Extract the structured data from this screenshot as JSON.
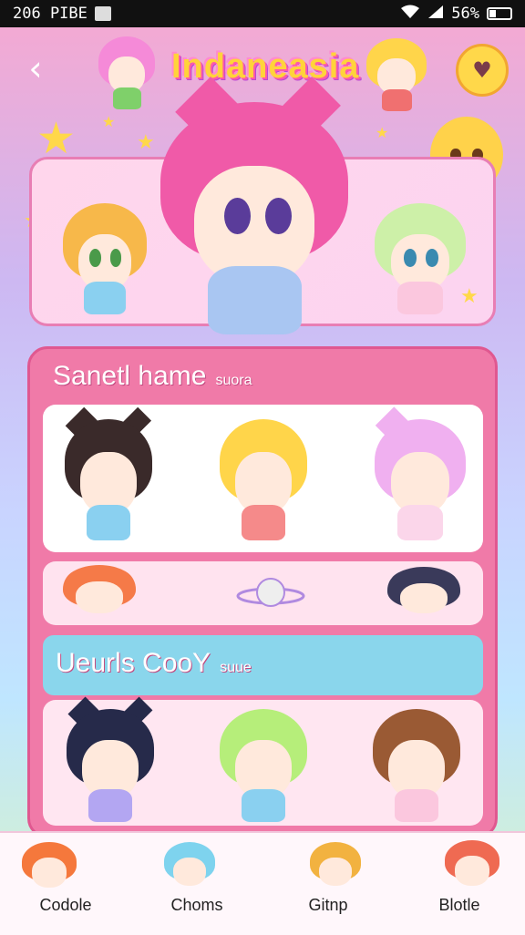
{
  "status_bar": {
    "time": "206 PIBE",
    "signal": "56%"
  },
  "header": {
    "title": "Indaneasia",
    "back_icon": "chevron-left-icon",
    "action_icon": "heart-icon"
  },
  "sections": [
    {
      "title": "Sanetl hame",
      "subtitle": "suora"
    },
    {
      "title": "Ueurls CooY",
      "subtitle": "suue"
    }
  ],
  "tabs": [
    {
      "label": "Codole"
    },
    {
      "label": "Choms"
    },
    {
      "label": "Gitnp"
    },
    {
      "label": "Blotle"
    }
  ],
  "colors": {
    "accent": "#f07aa8",
    "title": "#ffd33a",
    "banner": "#8ad6ec"
  }
}
